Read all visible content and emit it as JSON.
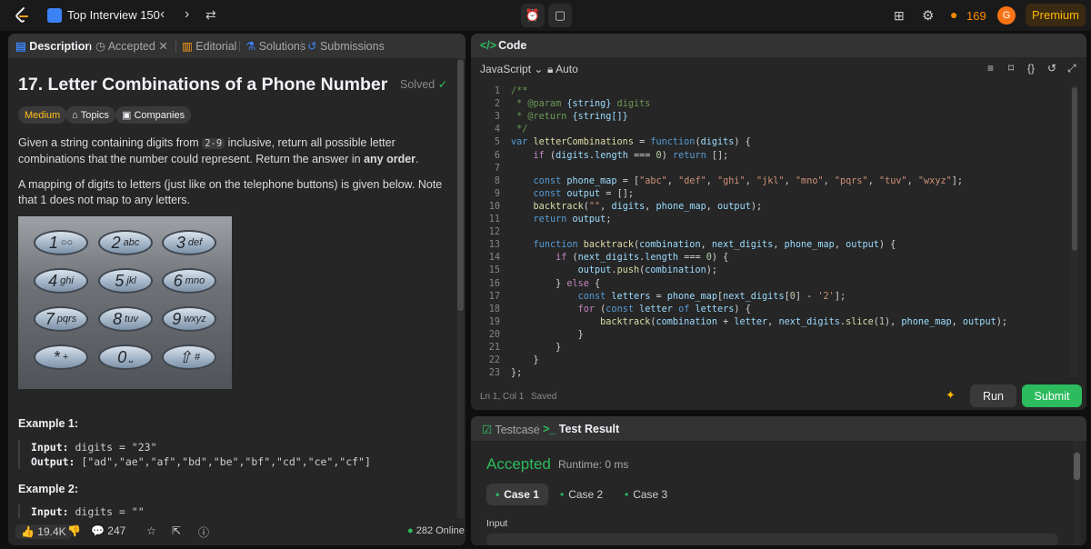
{
  "topbar": {
    "list_title": "Top Interview 150",
    "streak": "169",
    "avatar_letter": "G",
    "premium_label": "Premium"
  },
  "left": {
    "tabs": [
      "Description",
      "Accepted",
      "Editorial",
      "Solutions",
      "Submissions"
    ],
    "title": "17. Letter Combinations of a Phone Number",
    "solved_label": "Solved",
    "chips": [
      "Medium",
      "Topics",
      "Companies"
    ],
    "desc1_a": "Given a string containing digits from ",
    "desc1_code": "2-9",
    "desc1_b": " inclusive, return all possible letter combinations that the number could represent. Return the answer in ",
    "desc1_bold": "any order",
    "desc1_c": ".",
    "desc2": "A mapping of digits to letters (just like on the telephone buttons) is given below. Note that 1 does not map to any letters.",
    "keypad": [
      {
        "d": "1",
        "l": "○○"
      },
      {
        "d": "2",
        "l": "abc"
      },
      {
        "d": "3",
        "l": "def"
      },
      {
        "d": "4",
        "l": "ghi"
      },
      {
        "d": "5",
        "l": "jkl"
      },
      {
        "d": "6",
        "l": "mno"
      },
      {
        "d": "7",
        "l": "pqrs"
      },
      {
        "d": "8",
        "l": "tuv"
      },
      {
        "d": "9",
        "l": "wxyz"
      },
      {
        "d": "*",
        "l": "+"
      },
      {
        "d": "0",
        "l": "⎵"
      },
      {
        "d": "⇧",
        "l": "#"
      }
    ],
    "example1": {
      "heading": "Example 1:",
      "input_label": "Input:",
      "input_value": "digits = \"23\"",
      "output_label": "Output:",
      "output_value": "[\"ad\",\"ae\",\"af\",\"bd\",\"be\",\"bf\",\"cd\",\"ce\",\"cf\"]"
    },
    "example2": {
      "heading": "Example 2:",
      "input_label": "Input:",
      "input_value": "digits = \"\""
    },
    "likes": "19.4K",
    "comments": "247",
    "online": "282 Online"
  },
  "code": {
    "title": "Code",
    "language": "JavaScript",
    "mode": "Auto",
    "lines": [
      "/**",
      " * @param {string} digits",
      " * @return {string[]}",
      " */",
      "var letterCombinations = function(digits) {",
      "    if (digits.length === 0) return [];",
      "",
      "    const phone_map = [\"abc\", \"def\", \"ghi\", \"jkl\", \"mno\", \"pqrs\", \"tuv\", \"wxyz\"];",
      "    const output = [];",
      "    backtrack(\"\", digits, phone_map, output);",
      "    return output;",
      "",
      "    function backtrack(combination, next_digits, phone_map, output) {",
      "        if (next_digits.length === 0) {",
      "            output.push(combination);",
      "        } else {",
      "            const letters = phone_map[next_digits[0] - '2'];",
      "            for (const letter of letters) {",
      "                backtrack(combination + letter, next_digits.slice(1), phone_map, output);",
      "            }",
      "        }",
      "    }",
      "};"
    ],
    "cursor": "Ln 1, Col 1",
    "saved": "Saved",
    "run_label": "Run",
    "submit_label": "Submit"
  },
  "result": {
    "tabs": [
      "Testcase",
      "Test Result"
    ],
    "status": "Accepted",
    "runtime": "Runtime: 0 ms",
    "cases": [
      "Case 1",
      "Case 2",
      "Case 3"
    ],
    "input_label": "Input"
  },
  "colors": {
    "accent_green": "#2cbb5d",
    "medium": "#ffc01e",
    "premium": "#ffb800",
    "streak": "#ff8a00"
  }
}
